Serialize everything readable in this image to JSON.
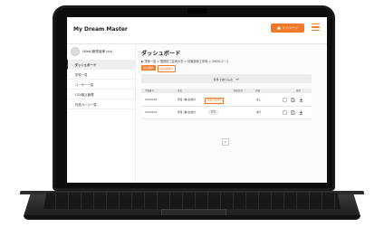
{
  "app": {
    "title": "My Dream Master",
    "my_page_label": "マイページ"
  },
  "user": {
    "name": "(Web)管理者様 (ex)"
  },
  "sidebar": {
    "items": [
      {
        "label": "ダッシュボード",
        "active": true
      },
      {
        "label": "学校一覧",
        "active": false
      },
      {
        "label": "ユーザー一覧",
        "active": false
      },
      {
        "label": "CSV取込管理",
        "active": false
      },
      {
        "label": "作品ページ一覧",
        "active": false
      }
    ]
  },
  "main": {
    "title": "ダッシュボード",
    "breadcrumb": "▶ 学校一覧  >  国際技工芸術大学  >  情報技術工学科  >  2NGKコース",
    "tabs": [
      "提出期間",
      "提出期間外"
    ],
    "filter_label": "条件で絞り込む",
    "columns": [
      "学籍番号",
      "氏名",
      "",
      "",
      "提出状況",
      "評価",
      "",
      "",
      "操作"
    ],
    "rows": [
      {
        "id": "XXXXXXX",
        "name": "学生 (無)名前付",
        "status": "未提出(初期)",
        "eval": "なし"
      },
      {
        "id": "XXXXXXX",
        "name": "学生 (無)名前付",
        "status": "提出",
        "eval": "あり"
      }
    ],
    "page": "1"
  },
  "colors": {
    "accent": "#f07a2a"
  }
}
